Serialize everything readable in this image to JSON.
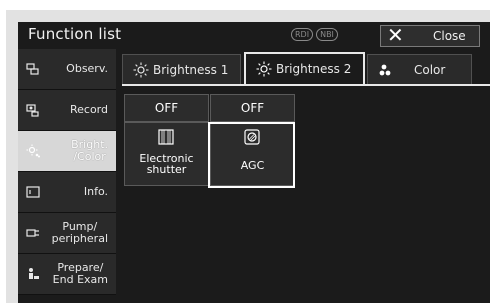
{
  "window": {
    "title": "Function list",
    "mode_badges": [
      "RDI",
      "NBI"
    ],
    "close_label": "Close"
  },
  "sidebar": {
    "items": [
      {
        "label": "Observ.",
        "icon": "observ-icon",
        "active": false
      },
      {
        "label": "Record",
        "icon": "record-icon",
        "active": false
      },
      {
        "label": "Bright.\n/Color",
        "icon": "brightness-icon",
        "active": true
      },
      {
        "label": "Info.",
        "icon": "info-icon",
        "active": false
      },
      {
        "label": "Pump/\nperipheral",
        "icon": "pump-icon",
        "active": false
      },
      {
        "label": "Prepare/\nEnd Exam",
        "icon": "prepare-icon",
        "active": false
      }
    ]
  },
  "tabs": [
    {
      "label": "Brightness 1",
      "icon": "sun-icon",
      "active": false
    },
    {
      "label": "Brightness 2",
      "icon": "sun-icon",
      "active": true
    },
    {
      "label": "Color",
      "icon": "color-dots-icon",
      "active": false
    }
  ],
  "functions": [
    {
      "state": "OFF",
      "label": "Electronic\nshutter",
      "icon": "shutter-icon",
      "selected": false
    },
    {
      "state": "OFF",
      "label": "AGC",
      "icon": "agc-icon",
      "selected": true
    }
  ],
  "colors": {
    "accent": "#ffffff",
    "panel": "#1b1b1b",
    "button": "#2c2c2c",
    "active_sidebar": "#d7d7d7"
  }
}
